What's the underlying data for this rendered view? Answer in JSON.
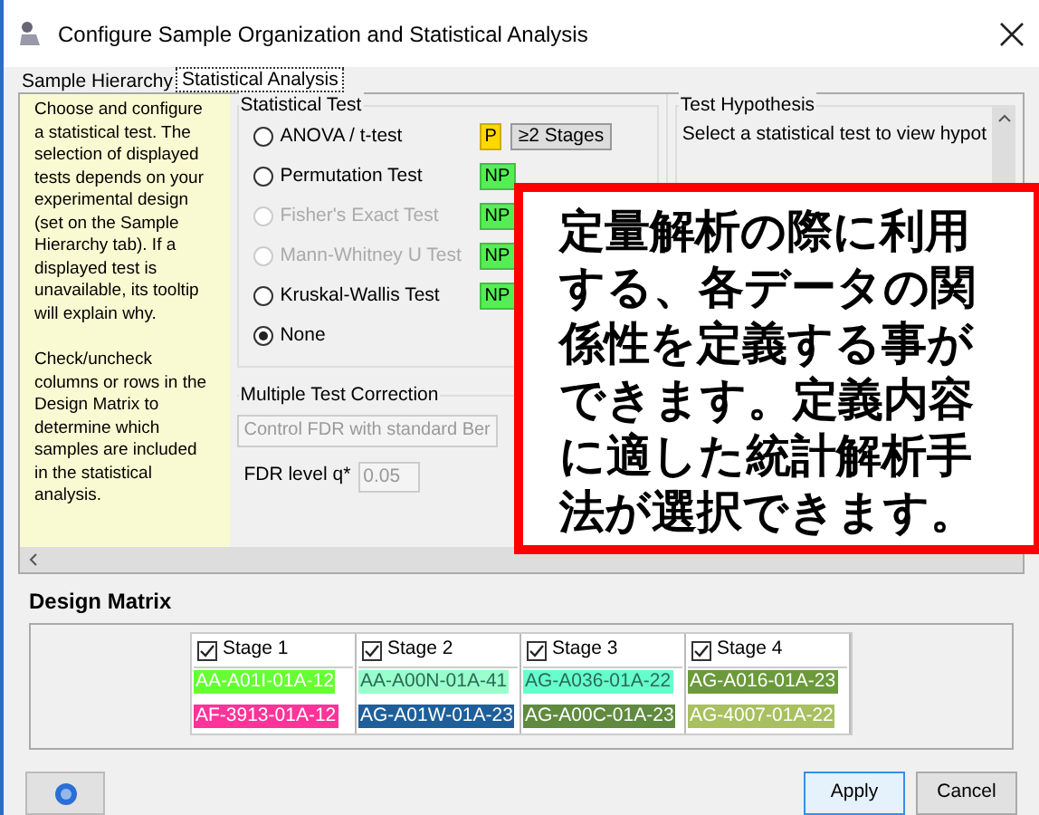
{
  "window": {
    "title": "Configure Sample Organization and Statistical Analysis"
  },
  "tabs": [
    {
      "label": "Sample Hierarchy",
      "selected": false
    },
    {
      "label": "Statistical Analysis",
      "selected": true
    }
  ],
  "help_text": [
    "Choose and configure a statistical test. The selection of displayed tests depends on your experimental design (set on the Sample Hierarchy tab). If a displayed test is unavailable, its tooltip will explain why.",
    "Check/uncheck columns or rows in the Design Matrix to determine which samples are included in the statistical analysis."
  ],
  "statistical_test": {
    "title": "Statistical Test",
    "tests": [
      {
        "label": "ANOVA / t-test",
        "selected": false,
        "disabled": false,
        "badge": "P",
        "color": "#ffd800",
        "option": "≥2 Stages"
      },
      {
        "label": "Permutation Test",
        "selected": false,
        "disabled": false,
        "badge": "NP",
        "color": "#55ee55"
      },
      {
        "label": "Fisher's Exact Test",
        "selected": false,
        "disabled": true,
        "badge": "NP",
        "color": "#55ee55"
      },
      {
        "label": "Mann-Whitney U Test",
        "selected": false,
        "disabled": true,
        "badge": "NP",
        "color": "#55ee55"
      },
      {
        "label": "Kruskal-Wallis Test",
        "selected": false,
        "disabled": false,
        "badge": "NP",
        "color": "#55ee55"
      },
      {
        "label": "None",
        "selected": true,
        "disabled": false
      }
    ]
  },
  "multiple_test_correction": {
    "title": "Multiple Test Correction",
    "method": "Control FDR with standard Ber",
    "fdr_label": "FDR level q*",
    "fdr_value": "0.05"
  },
  "test_hypothesis": {
    "title": "Test Hypothesis",
    "text": "Select a statistical test to view hypot"
  },
  "callout": "定量解析の際に利用する、各データの関係性を定義する事ができます。定義内容に適した統計解析手法が選択できます。",
  "design_matrix": {
    "title": "Design Matrix",
    "columns": [
      {
        "label": "Stage 1",
        "checked": true,
        "samples": [
          {
            "label": "AA-A01I-01A-12",
            "color": "#66ff33"
          },
          {
            "label": "AF-3913-01A-12",
            "color": "#ff3399"
          }
        ]
      },
      {
        "label": "Stage 2",
        "checked": true,
        "samples": [
          {
            "label": "AA-A00N-01A-41",
            "color": "#99ffcc"
          },
          {
            "label": "AG-A01W-01A-23",
            "color": "#1f5f99"
          }
        ]
      },
      {
        "label": "Stage 3",
        "checked": true,
        "samples": [
          {
            "label": "AG-A036-01A-22",
            "color": "#66ffcc"
          },
          {
            "label": "AG-A00C-01A-23",
            "color": "#5f8a3f"
          }
        ]
      },
      {
        "label": "Stage 4",
        "checked": true,
        "samples": [
          {
            "label": "AG-A016-01A-23",
            "color": "#6b9a3a"
          },
          {
            "label": "AG-4007-01A-22",
            "color": "#a8c060"
          }
        ]
      }
    ]
  },
  "buttons": [
    {
      "label": "Apply",
      "kind": "primary"
    },
    {
      "label": "Cancel",
      "kind": "normal"
    }
  ]
}
